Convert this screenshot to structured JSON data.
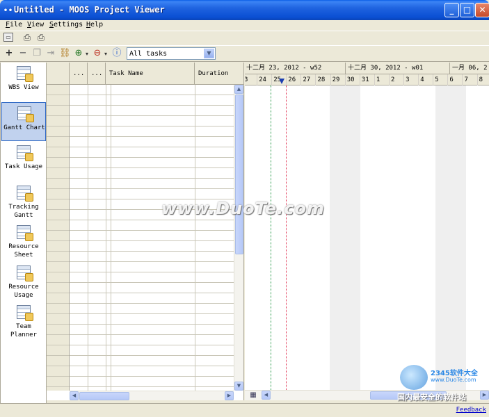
{
  "window": {
    "title": "Untitled - MOOS Project Viewer",
    "title_dots": "••"
  },
  "menu": [
    {
      "label": "File"
    },
    {
      "label": "View"
    },
    {
      "label": "Settings"
    },
    {
      "label": "Help"
    }
  ],
  "toolbar": {
    "filter": {
      "selected": "All tasks"
    },
    "icons": [
      "open-icon",
      "print-icon",
      "print-preview-icon",
      "add-icon",
      "remove-icon",
      "copy-icon",
      "indent-icon",
      "link-icon",
      "zoom-in-icon",
      "zoom-out-icon",
      "info-icon"
    ]
  },
  "sidebar": {
    "views": [
      {
        "label": "WBS View",
        "active": false
      },
      {
        "label": "Gantt Chart",
        "active": true
      },
      {
        "label": "Task Usage",
        "active": false
      },
      {
        "label": "Tracking Gantt",
        "active": false
      },
      {
        "label": "Resource Sheet",
        "active": false
      },
      {
        "label": "Resource Usage",
        "active": false
      },
      {
        "label": "Team Planner",
        "active": false
      }
    ]
  },
  "grid": {
    "columns": [
      {
        "label": "..."
      },
      {
        "label": "..."
      },
      {
        "label": "Task Name"
      },
      {
        "label": "Duration"
      }
    ]
  },
  "gantt": {
    "weeks": [
      "十二月 23, 2012 - w52",
      "十二月 30, 2012 - w01",
      "一月 06, 2"
    ],
    "days": [
      "3",
      "24",
      "25",
      "26",
      "27",
      "28",
      "29",
      "30",
      "31",
      "1",
      "2",
      "3",
      "4",
      "5",
      "6",
      "7",
      "8"
    ],
    "today_color": "#1c3fb0",
    "status_line_color": "#e03050",
    "baseline_color": "#2a9a4a"
  },
  "status": {
    "feedback": "Feedback"
  },
  "watermark": {
    "main": "www.DuoTe.com",
    "brand": "2345软件大全",
    "url": "www.DuoTe.com",
    "tagline": "国内最安全的软件站"
  }
}
